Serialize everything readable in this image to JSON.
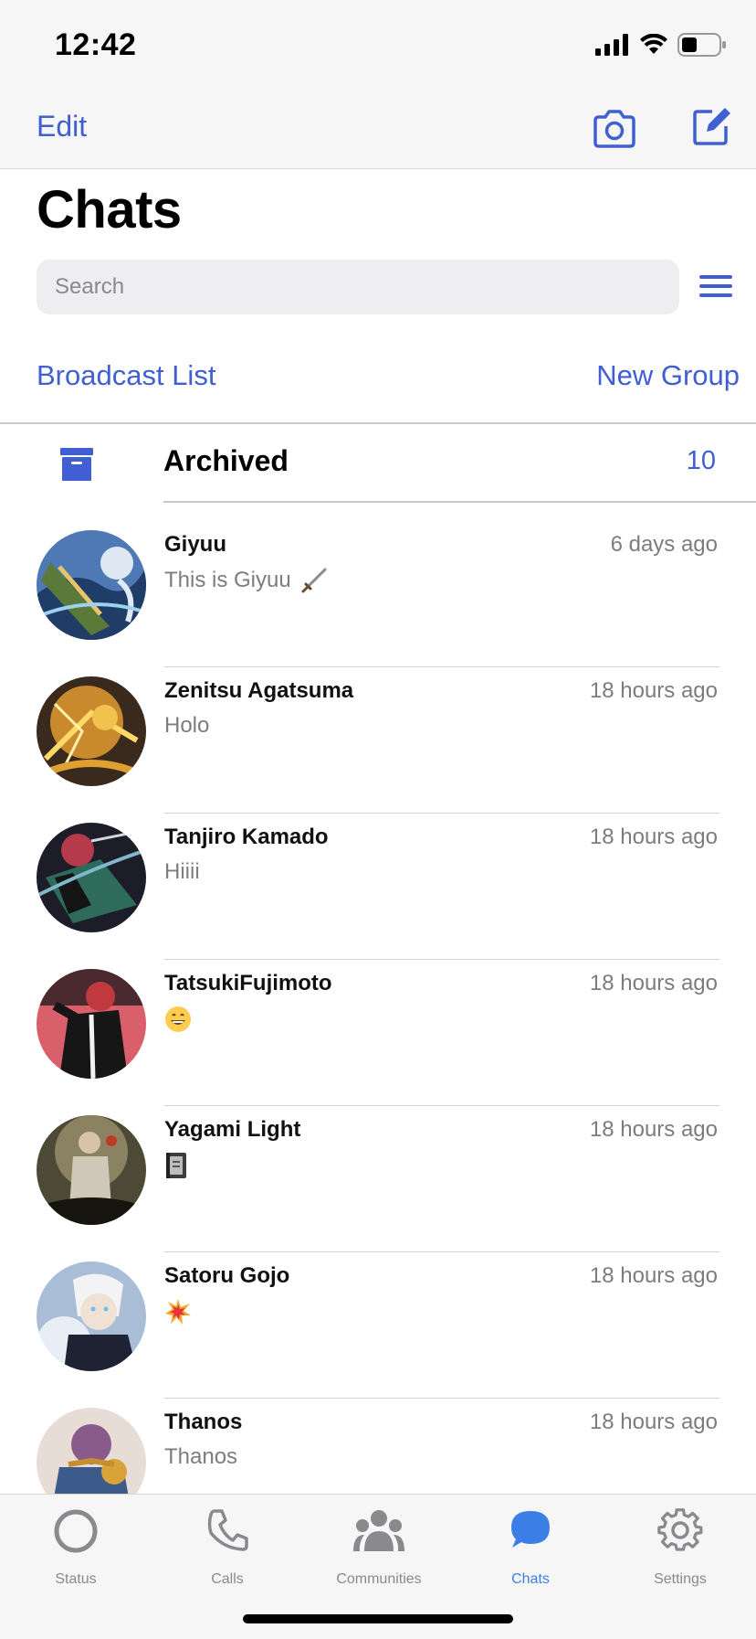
{
  "status_bar": {
    "time": "12:42"
  },
  "nav": {
    "edit_label": "Edit"
  },
  "page": {
    "title": "Chats"
  },
  "search": {
    "placeholder": "Search"
  },
  "links": {
    "broadcast": "Broadcast List",
    "new_group": "New Group"
  },
  "archived": {
    "label": "Archived",
    "count": "10"
  },
  "chats": [
    {
      "name": "Giyuu",
      "time": "6 days ago",
      "preview": "This is Giyuu",
      "preview_icon": "dagger-icon"
    },
    {
      "name": "Zenitsu Agatsuma",
      "time": "18 hours ago",
      "preview": "Holo",
      "preview_icon": ""
    },
    {
      "name": "Tanjiro Kamado",
      "time": "18 hours ago",
      "preview": "Hiiii",
      "preview_icon": ""
    },
    {
      "name": "TatsukiFujimoto",
      "time": "18 hours ago",
      "preview": "",
      "preview_icon": "grinning-face-emoji"
    },
    {
      "name": "Yagami Light",
      "time": "18 hours ago",
      "preview": "",
      "preview_icon": "notebook-emoji"
    },
    {
      "name": "Satoru Gojo",
      "time": "18 hours ago",
      "preview": "",
      "preview_icon": "collision-emoji"
    },
    {
      "name": "Thanos",
      "time": "18 hours ago",
      "preview": "Thanos",
      "preview_icon": ""
    }
  ],
  "tabs": [
    {
      "label": "Status",
      "icon": "status-icon",
      "active": false
    },
    {
      "label": "Calls",
      "icon": "phone-icon",
      "active": false
    },
    {
      "label": "Communities",
      "icon": "communities-icon",
      "active": false
    },
    {
      "label": "Chats",
      "icon": "chat-bubble-icon",
      "active": true
    },
    {
      "label": "Settings",
      "icon": "gear-icon",
      "active": false
    }
  ],
  "colors": {
    "accent": "#3f5fd2",
    "tab_active": "#3b7ee6",
    "secondary_text": "#7d7d80",
    "bar_bg": "#f6f6f6"
  }
}
